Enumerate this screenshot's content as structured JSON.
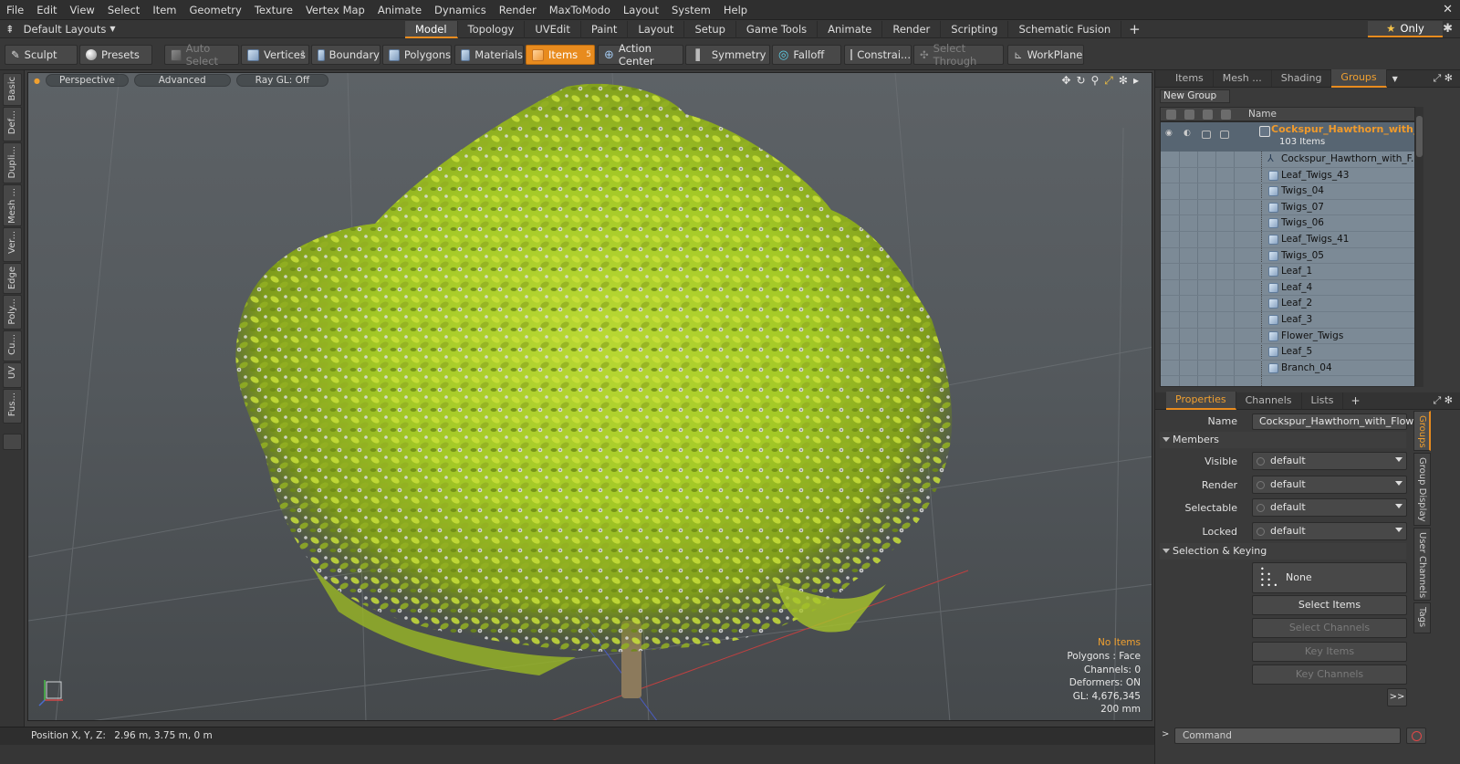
{
  "menubar": {
    "items": [
      "File",
      "Edit",
      "View",
      "Select",
      "Item",
      "Geometry",
      "Texture",
      "Vertex Map",
      "Animate",
      "Dynamics",
      "Render",
      "MaxToModo",
      "Layout",
      "System",
      "Help"
    ]
  },
  "layoutbar": {
    "layout_name": "Default Layouts",
    "tabs": [
      "Model",
      "Topology",
      "UVEdit",
      "Paint",
      "Layout",
      "Setup",
      "Game Tools",
      "Animate",
      "Render",
      "Scripting",
      "Schematic Fusion"
    ],
    "active_tab": "Model",
    "only_label": "Only"
  },
  "toolbar": {
    "sculpt": "Sculpt",
    "presets": "Presets",
    "auto_select": "Auto Select",
    "vertices": "Vertices",
    "vertices_count": "1",
    "boundary": "Boundary",
    "polygons": "Polygons",
    "materials": "Materials",
    "items": "Items",
    "items_count": "5",
    "action_center": "Action Center",
    "symmetry": "Symmetry",
    "falloff": "Falloff",
    "constraints": "Constrai...",
    "select_through": "Select Through",
    "workplane": "WorkPlane"
  },
  "leftstrip": {
    "tabs": [
      "Basic",
      "Def...",
      "Dupli...",
      "Mesh ...",
      "Ver...",
      "Edge",
      "Poly...",
      "Cu...",
      "UV",
      "Fus..."
    ]
  },
  "viewport": {
    "view_mode": "Perspective",
    "shading": "Advanced",
    "raygl": "Ray GL: Off",
    "stats": {
      "selection": "No Items",
      "polygons": "Polygons : Face",
      "channels": "Channels: 0",
      "deformers": "Deformers: ON",
      "gl": "GL: 4,676,345",
      "scale": "200 mm"
    }
  },
  "statusbar": {
    "position_label": "Position X, Y, Z:",
    "position_value": "2.96 m, 3.75 m, 0 m"
  },
  "itemspanel": {
    "tabs": [
      "Items",
      "Mesh ...",
      "Shading",
      "Groups"
    ],
    "active_tab": "Groups",
    "new_group": "New Group",
    "name_header": "Name",
    "group": {
      "name": "Cockspur_Hawthorn_with_...",
      "count": "103 Items"
    },
    "items": [
      "Cockspur_Hawthorn_with_F...",
      "Leaf_Twigs_43",
      "Twigs_04",
      "Twigs_07",
      "Twigs_06",
      "Leaf_Twigs_41",
      "Twigs_05",
      "Leaf_1",
      "Leaf_4",
      "Leaf_2",
      "Leaf_3",
      "Flower_Twigs",
      "Leaf_5",
      "Branch_04"
    ]
  },
  "properties": {
    "tabs": [
      "Properties",
      "Channels",
      "Lists"
    ],
    "active_tab": "Properties",
    "name_label": "Name",
    "name_value": "Cockspur_Hawthorn_with_Flower",
    "members_header": "Members",
    "visible_label": "Visible",
    "visible_value": "default",
    "render_label": "Render",
    "render_value": "default",
    "selectable_label": "Selectable",
    "selectable_value": "default",
    "locked_label": "Locked",
    "locked_value": "default",
    "selkey_header": "Selection & Keying",
    "none_label": "None",
    "select_items": "Select Items",
    "select_channels": "Select Channels",
    "key_items": "Key Items",
    "key_channels": "Key Channels",
    "more": ">>",
    "side_tabs": [
      "Groups",
      "Group Display",
      "User Channels",
      "Tags"
    ]
  },
  "command": {
    "placeholder": "Command"
  }
}
